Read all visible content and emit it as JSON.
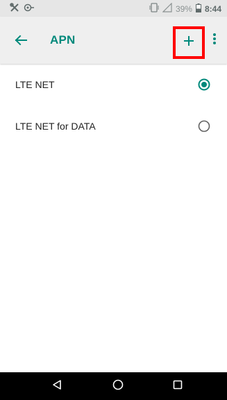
{
  "status_bar": {
    "left_icons": [
      "tools-icon",
      "cast-icon"
    ],
    "battery_percent": "39%",
    "time": "8:44"
  },
  "app_bar": {
    "title": "APN",
    "accent_color": "#00897b",
    "actions": [
      "back-icon",
      "add-icon",
      "more-vert-icon"
    ]
  },
  "apn_list": [
    {
      "label": "LTE NET",
      "selected": true
    },
    {
      "label": "LTE NET for DATA",
      "selected": false
    }
  ],
  "nav_bar": {
    "buttons": [
      "back-triangle-icon",
      "home-circle-icon",
      "recents-square-icon"
    ]
  }
}
